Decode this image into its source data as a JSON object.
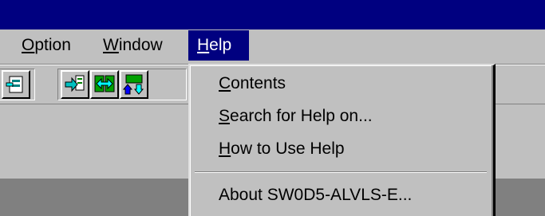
{
  "menubar": {
    "items": [
      {
        "mnemonic": "O",
        "rest": "ption"
      },
      {
        "mnemonic": "W",
        "rest": "indow"
      },
      {
        "mnemonic": "H",
        "rest": "elp"
      }
    ]
  },
  "toolbar": {
    "buttons": [
      "panel-icon",
      "transfer-right-icon",
      "transfer-both-icon",
      "transfer-updown-icon"
    ]
  },
  "help_menu": {
    "items": [
      {
        "mnemonic": "C",
        "rest": "ontents"
      },
      {
        "mnemonic": "S",
        "rest": "earch for Help on..."
      },
      {
        "mnemonic": "H",
        "rest": "ow to Use Help"
      },
      {
        "text": "About SW0D5-ALVLS-E..."
      }
    ]
  },
  "colors": {
    "titlebar": "#000080",
    "face": "#c0c0c0",
    "workspace": "#808080",
    "highlight": "#000080"
  }
}
